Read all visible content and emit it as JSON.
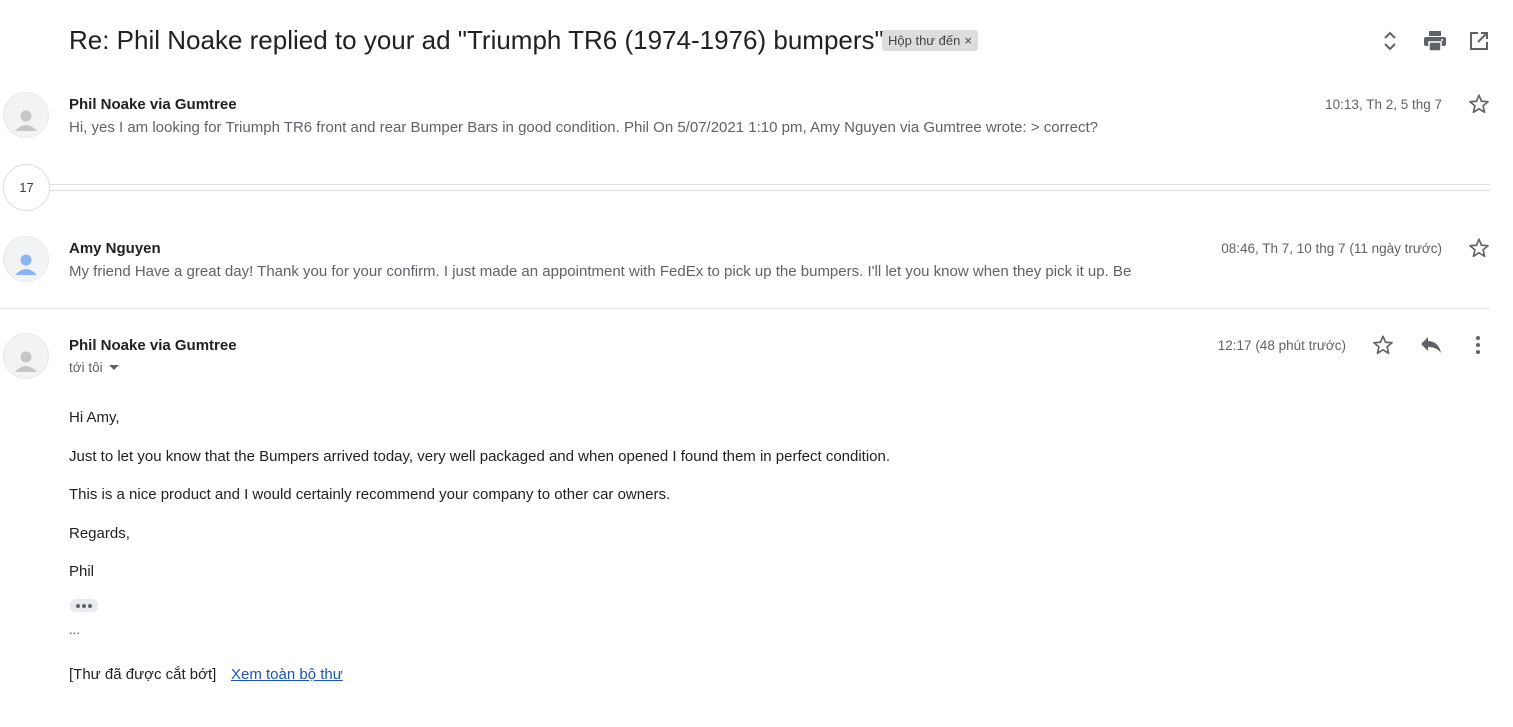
{
  "thread": {
    "subject": "Re: Phil Noake replied to your ad \"Triumph TR6 (1974-1976) bumpers\"",
    "label": "Hộp thư đến",
    "label_remove": "×"
  },
  "header_icons": [
    "expand-collapse-icon",
    "print-icon",
    "open-in-new-window-icon"
  ],
  "collapsed_count": "17",
  "messages": [
    {
      "sender": "Phil Noake via Gumtree",
      "time": "10:13, Th 2, 5 thg 7",
      "snippet": "Hi, yes I am looking for Triumph TR6 front and rear Bumper Bars in good condition. Phil On 5/07/2021 1:10 pm, Amy Nguyen via Gumtree wrote: > correct?"
    },
    {
      "sender": "Amy Nguyen",
      "time": "08:46, Th 7, 10 thg 7 (11 ngày trước)",
      "snippet": "My friend Have a great day! Thank you for your confirm. I just made an appointment with FedEx to pick up the bumpers. I'll let you know when they pick it up. Be"
    },
    {
      "sender": "Phil Noake via Gumtree",
      "time": "12:17 (48 phút trước)",
      "to": "tới tôi",
      "body": [
        "Hi Amy,",
        "Just to let you know that the Bumpers arrived today, very well packaged and when opened I found them in perfect condition.",
        "This is a nice product and I would certainly recommend your company to other car owners.",
        "Regards,",
        "Phil"
      ],
      "quoted_dots": "...",
      "trimmed_label": "[Thư đã được cắt bớt]",
      "view_all_label": "Xem toàn bộ thư"
    }
  ],
  "colors": {
    "avatar_grey": "#c4c7c5",
    "avatar_blue": "#8ab4f8",
    "link": "#1a55b5"
  }
}
